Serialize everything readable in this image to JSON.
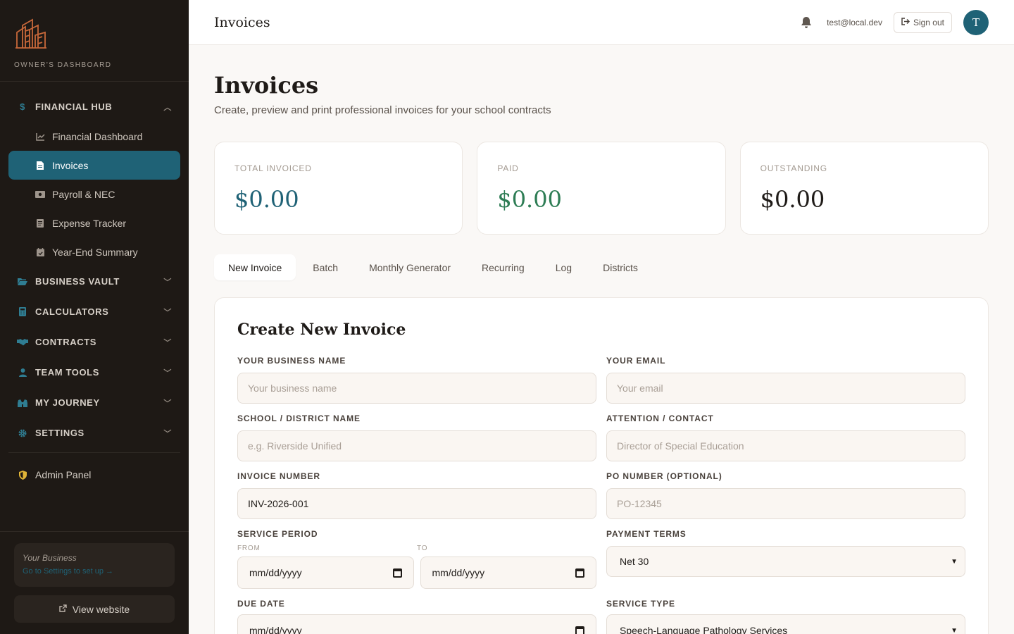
{
  "brand": {
    "label": "OWNER'S DASHBOARD"
  },
  "nav": {
    "financial_hub": {
      "label": "FINANCIAL HUB",
      "items": [
        {
          "label": "Financial Dashboard"
        },
        {
          "label": "Invoices"
        },
        {
          "label": "Payroll & NEC"
        },
        {
          "label": "Expense Tracker"
        },
        {
          "label": "Year-End Summary"
        }
      ]
    },
    "sections": [
      {
        "label": "BUSINESS VAULT"
      },
      {
        "label": "CALCULATORS"
      },
      {
        "label": "CONTRACTS"
      },
      {
        "label": "TEAM TOOLS"
      },
      {
        "label": "MY JOURNEY"
      },
      {
        "label": "SETTINGS"
      }
    ],
    "admin": "Admin Panel"
  },
  "business_card": {
    "title": "Your Business",
    "link": "Go to Settings to set up →"
  },
  "view_website": "View website",
  "topbar": {
    "title": "Invoices",
    "email": "test@local.dev",
    "signout": "Sign out",
    "avatar": "T"
  },
  "page": {
    "title": "Invoices",
    "subtitle": "Create, preview and print professional invoices for your school contracts"
  },
  "stats": [
    {
      "label": "TOTAL INVOICED",
      "value": "$0.00",
      "color": "#1f6276"
    },
    {
      "label": "PAID",
      "value": "$0.00",
      "color": "#2e7d55"
    },
    {
      "label": "OUTSTANDING",
      "value": "$0.00",
      "color": "#1f1b18"
    }
  ],
  "tabs": [
    "New Invoice",
    "Batch",
    "Monthly Generator",
    "Recurring",
    "Log",
    "Districts"
  ],
  "form": {
    "title": "Create New Invoice",
    "business_name": {
      "label": "YOUR BUSINESS NAME",
      "placeholder": "Your business name"
    },
    "email": {
      "label": "YOUR EMAIL",
      "placeholder": "Your email"
    },
    "school": {
      "label": "SCHOOL / DISTRICT NAME",
      "placeholder": "e.g. Riverside Unified"
    },
    "attention": {
      "label": "ATTENTION / CONTACT",
      "placeholder": "Director of Special Education"
    },
    "invoice_number": {
      "label": "INVOICE NUMBER",
      "value": "INV-2026-001"
    },
    "po_number": {
      "label": "PO NUMBER (OPTIONAL)",
      "placeholder": "PO-12345"
    },
    "service_period": {
      "label": "SERVICE PERIOD",
      "from_label": "FROM",
      "to_label": "TO",
      "from_value": "mm/dd/yyyy",
      "to_value": "mm/dd/yyyy"
    },
    "payment_terms": {
      "label": "PAYMENT TERMS",
      "value": "Net 30"
    },
    "due_date": {
      "label": "DUE DATE",
      "value": "mm/dd/yyyy"
    },
    "service_type": {
      "label": "SERVICE TYPE",
      "value": "Speech-Language Pathology Services"
    }
  }
}
